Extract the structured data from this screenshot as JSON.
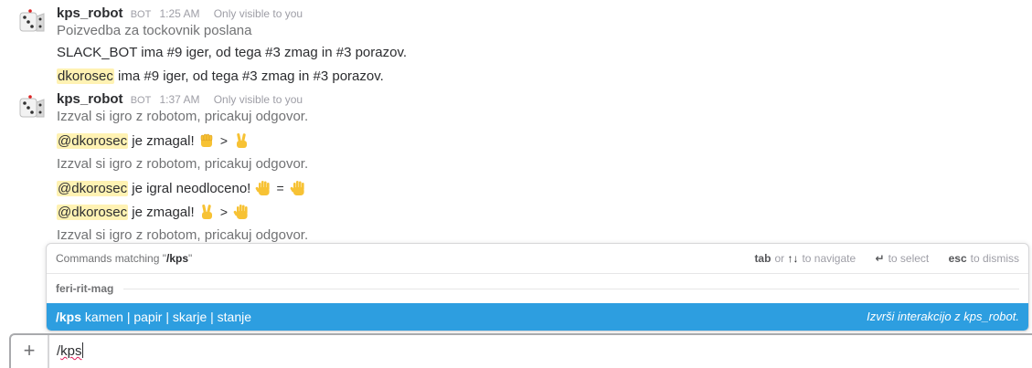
{
  "messages": [
    {
      "author": "kps_robot",
      "badge": "BOT",
      "time": "1:25 AM",
      "visibility": "Only visible to you",
      "avatar_icon": "dice-icon",
      "lines": {
        "l1": "Poizvedba za tockovnik poslana",
        "l2": "SLACK_BOT ima #9 iger, od tega #3 zmag in #3 porazov.",
        "l3_mention": "dkorosec",
        "l3_text": " ima #9 iger, od tega #3 zmag in #3 porazov."
      }
    },
    {
      "author": "kps_robot",
      "badge": "BOT",
      "time": "1:37 AM",
      "visibility": "Only visible to you",
      "avatar_icon": "dice-icon",
      "lines": {
        "l1": "Izzval si igro z robotom, pricakuj odgovor.",
        "l2_mention": "@dkorosec",
        "l2_text": " je zmagal!",
        "l2_op": ">",
        "l3": "Izzval si igro z robotom, pricakuj odgovor.",
        "l4_mention": "@dkorosec",
        "l4_text": " je igral neodloceno!",
        "l4_op": "=",
        "l5_mention": "@dkorosec",
        "l5_text": " je zmagal!",
        "l5_op": ">",
        "l6": "Izzval si igro z robotom, pricakuj odgovor."
      }
    }
  ],
  "emojis": {
    "row2": [
      "fist-emoji",
      "victory-hand-emoji"
    ],
    "row4": [
      "raised-hand-emoji",
      "raised-hand-emoji"
    ],
    "row5": [
      "victory-hand-emoji",
      "raised-hand-emoji"
    ]
  },
  "popup": {
    "matching_prefix": "Commands matching \"",
    "matching_query": "/kps",
    "matching_suffix": "\"",
    "hint_tab_key": "tab",
    "hint_or": "or",
    "hint_arrows": "↑↓",
    "hint_navigate": "to navigate",
    "hint_enter_key": "↵",
    "hint_select": "to select",
    "hint_esc_key": "esc",
    "hint_dismiss": "to dismiss",
    "group_label": "feri-rit-mag",
    "command": "/kps",
    "command_args": "kamen | papir | skarje | stanje",
    "command_desc": "Izvrši interakcijo z kps_robot."
  },
  "composer": {
    "plus_label": "+",
    "slash": "/",
    "typed": "kps"
  },
  "colors": {
    "accent": "#2d9ee0",
    "mention_bg": "#fff2b3",
    "muted": "#9e9ea6",
    "emoji_yellow": "#f7c234"
  }
}
